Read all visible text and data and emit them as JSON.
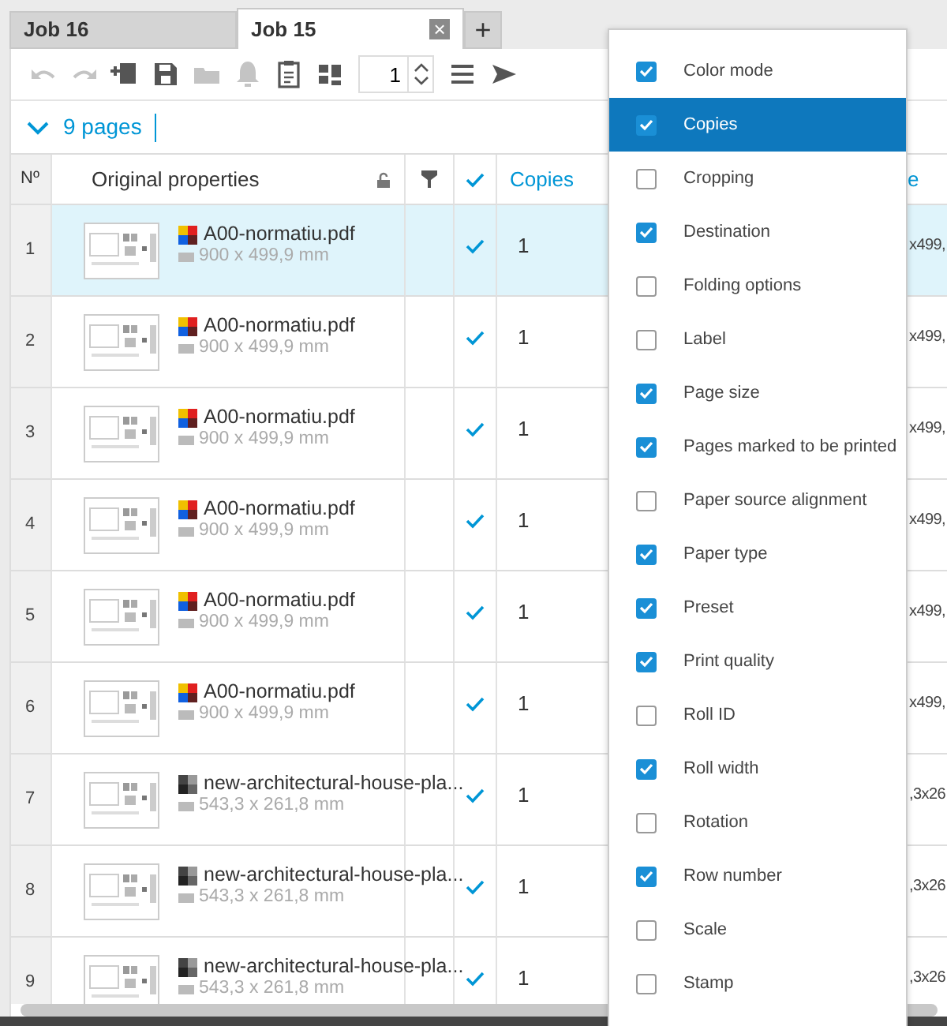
{
  "tabs": [
    {
      "label": "Job 16",
      "selected": false
    },
    {
      "label": "Job 15",
      "selected": true,
      "close": "×"
    },
    {
      "label": "+",
      "selected": false
    }
  ],
  "toolbar": {
    "buttons": [
      {
        "kind": "undo",
        "disabled": true
      },
      {
        "kind": "redo",
        "disabled": true
      },
      {
        "kind": "add",
        "disabled": false
      },
      {
        "kind": "save",
        "disabled": false
      },
      {
        "kind": "folder",
        "disabled": true
      },
      {
        "kind": "bell",
        "disabled": true
      },
      {
        "kind": "clipboard",
        "disabled": false
      },
      {
        "kind": "grid",
        "disabled": false
      }
    ],
    "copies_value": "1",
    "after": [
      {
        "kind": "menu",
        "disabled": false
      },
      {
        "kind": "send",
        "disabled": false
      }
    ]
  },
  "pages_toggle": {
    "label": "9 pages",
    "expanded": true
  },
  "table": {
    "columns": [
      {
        "kind": "text",
        "label": "Nº"
      },
      {
        "kind": "text",
        "label": "Original properties"
      },
      {
        "kind": "filter"
      },
      {
        "kind": "check"
      },
      {
        "kind": "text",
        "label": "Copies"
      },
      {
        "kind": "text",
        "label": "e"
      }
    ],
    "rows": [
      {
        "number": "1",
        "name": "A00-normatiu.pdf",
        "size": "900 x 499,9 mm",
        "kind": "color",
        "checked": true,
        "copies": "1",
        "column_6": "x499,",
        "selected": true
      },
      {
        "number": "2",
        "name": "A00-normatiu.pdf",
        "size": "900 x 499,9 mm",
        "kind": "color",
        "checked": true,
        "copies": "1",
        "column_6": "x499,",
        "selected": false
      },
      {
        "number": "3",
        "name": "A00-normatiu.pdf",
        "size": "900 x 499,9 mm",
        "kind": "color",
        "checked": true,
        "copies": "1",
        "column_6": "x499,",
        "selected": false
      },
      {
        "number": "4",
        "name": "A00-normatiu.pdf",
        "size": "900 x 499,9 mm",
        "kind": "color",
        "checked": true,
        "copies": "1",
        "column_6": "x499,",
        "selected": false
      },
      {
        "number": "5",
        "name": "A00-normatiu.pdf",
        "size": "900 x 499,9 mm",
        "kind": "color",
        "checked": true,
        "copies": "1",
        "column_6": "x499,",
        "selected": false
      },
      {
        "number": "6",
        "name": "A00-normatiu.pdf",
        "size": "900 x 499,9 mm",
        "kind": "color",
        "checked": true,
        "copies": "1",
        "column_6": "x499,",
        "selected": false
      },
      {
        "number": "7",
        "name": "new-architectural-house-pla...",
        "size": "543,3 x 261,8 mm",
        "kind": "grayscale",
        "checked": true,
        "copies": "1",
        "column_6": ",3x26",
        "selected": false
      },
      {
        "number": "8",
        "name": "new-architectural-house-pla...",
        "size": "543,3 x 261,8 mm",
        "kind": "grayscale",
        "checked": true,
        "copies": "1",
        "column_6": ",3x26",
        "selected": false
      },
      {
        "number": "9",
        "name": "new-architectural-house-pla...",
        "size": "543,3 x 261,8 mm",
        "kind": "grayscale",
        "checked": true,
        "copies": "1",
        "column_6": ",3x26",
        "selected": false
      }
    ]
  },
  "column_menu": {
    "items": [
      {
        "label": "Color mode",
        "checked": true,
        "selected": false
      },
      {
        "label": "Copies",
        "checked": true,
        "selected": true
      },
      {
        "label": "Cropping",
        "checked": false,
        "selected": false
      },
      {
        "label": "Destination",
        "checked": true,
        "selected": false
      },
      {
        "label": "Folding options",
        "checked": false,
        "selected": false
      },
      {
        "label": "Label",
        "checked": false,
        "selected": false
      },
      {
        "label": "Page size",
        "checked": true,
        "selected": false
      },
      {
        "label": "Pages marked to be printed",
        "checked": true,
        "selected": false
      },
      {
        "label": "Paper source alignment",
        "checked": false,
        "selected": false
      },
      {
        "label": "Paper type",
        "checked": true,
        "selected": false
      },
      {
        "label": "Preset",
        "checked": true,
        "selected": false
      },
      {
        "label": "Print quality",
        "checked": true,
        "selected": false
      },
      {
        "label": "Roll ID",
        "checked": false,
        "selected": false
      },
      {
        "label": "Roll width",
        "checked": true,
        "selected": false
      },
      {
        "label": "Rotation",
        "checked": false,
        "selected": false
      },
      {
        "label": "Row number",
        "checked": true,
        "selected": false
      },
      {
        "label": "Scale",
        "checked": false,
        "selected": false
      },
      {
        "label": "Stamp",
        "checked": false,
        "selected": false
      }
    ]
  }
}
